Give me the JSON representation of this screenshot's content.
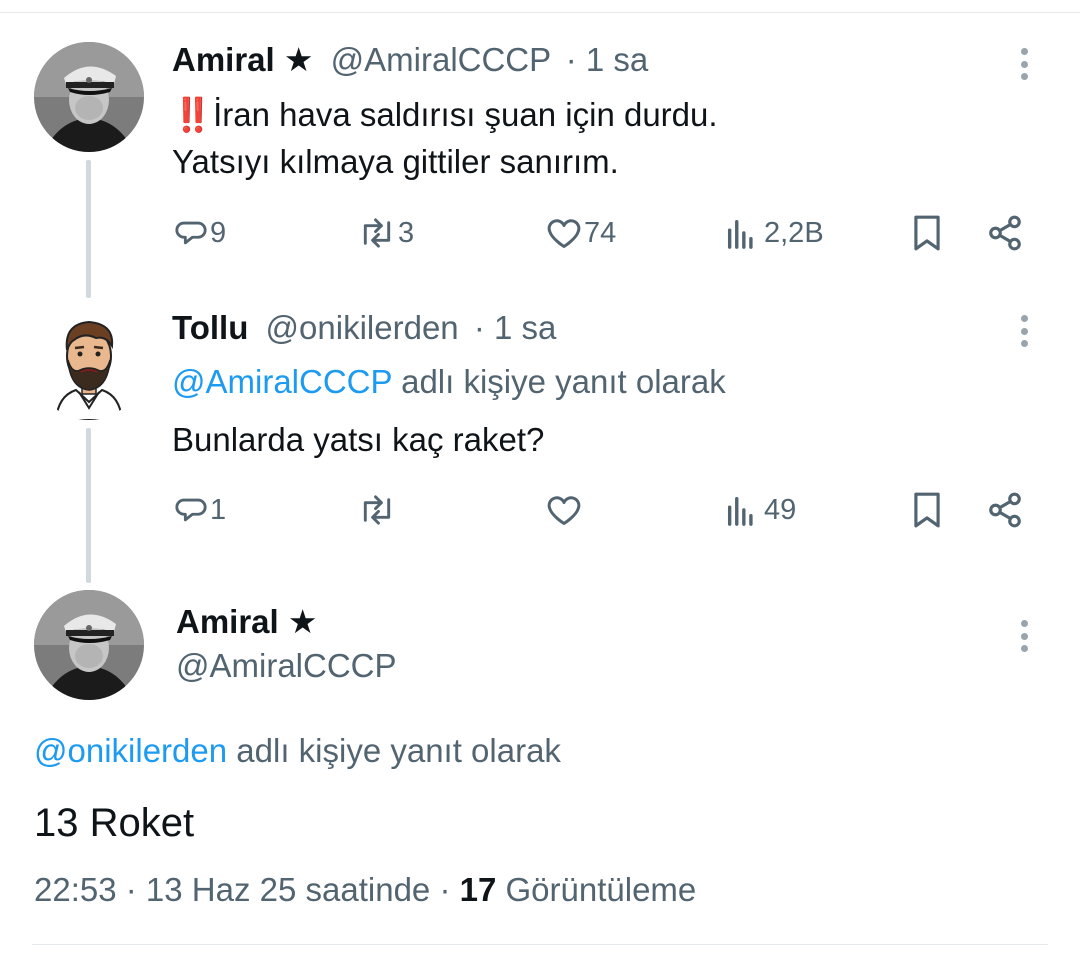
{
  "tweet1": {
    "name": "Amiral ★",
    "handle": "@AmiralCCCP",
    "time": "· 1 sa",
    "emoji": "‼️",
    "line1": "İran hava saldırısı şuan için durdu.",
    "line2": "Yatsıyı kılmaya gittiler sanırım.",
    "replies": "9",
    "retweets": "3",
    "likes": "74",
    "views": "2,2B"
  },
  "tweet2": {
    "name": "Tollu",
    "handle": "@onikilerden",
    "time": "· 1 sa",
    "reply_handle": "@AmiralCCCP",
    "reply_suffix": " adlı kişiye yanıt olarak",
    "text": "Bunlarda yatsı kaç raket?",
    "replies": "1",
    "retweets": "",
    "likes": "",
    "views": "49"
  },
  "main_tweet": {
    "name": "Amiral ★",
    "handle": "@AmiralCCCP",
    "reply_handle": "@onikilerden",
    "reply_suffix": " adlı kişiye yanıt olarak",
    "text": "13 Roket",
    "time": "22:53 · 13 Haz 25 saatinde · ",
    "view_count": "17",
    "view_label": " Görüntüleme"
  },
  "icons": [
    "reply-icon",
    "retweet-icon",
    "like-icon",
    "views-icon",
    "bookmark-icon",
    "share-icon",
    "more-icon"
  ],
  "colors": {
    "link": "#1d9bf0",
    "muted": "#536471",
    "text": "#0f1419",
    "thread": "#cfd9de",
    "emoji": "#f4212e"
  }
}
